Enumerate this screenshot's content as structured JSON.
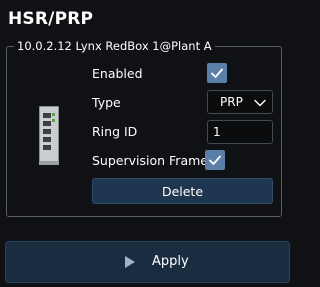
{
  "header": {
    "title": "HSR/PRP"
  },
  "device": {
    "name": "10.0.2.12 Lynx RedBox 1@Plant A",
    "image_icon": "device-hardware-icon"
  },
  "form": {
    "enabled_label": "Enabled",
    "enabled_checked": true,
    "type_label": "Type",
    "type_value": "PRP",
    "ring_id_label": "Ring ID",
    "ring_id_value": "1",
    "supervision_label": "Supervision Frames",
    "supervision_checked": true,
    "delete_label": "Delete"
  },
  "footer": {
    "apply_label": "Apply",
    "apply_icon": "play-icon"
  },
  "colors": {
    "background": "#101114",
    "checkbox": "#5b7fa6",
    "button": "#1f3650",
    "apply_button": "#1a2c40"
  }
}
